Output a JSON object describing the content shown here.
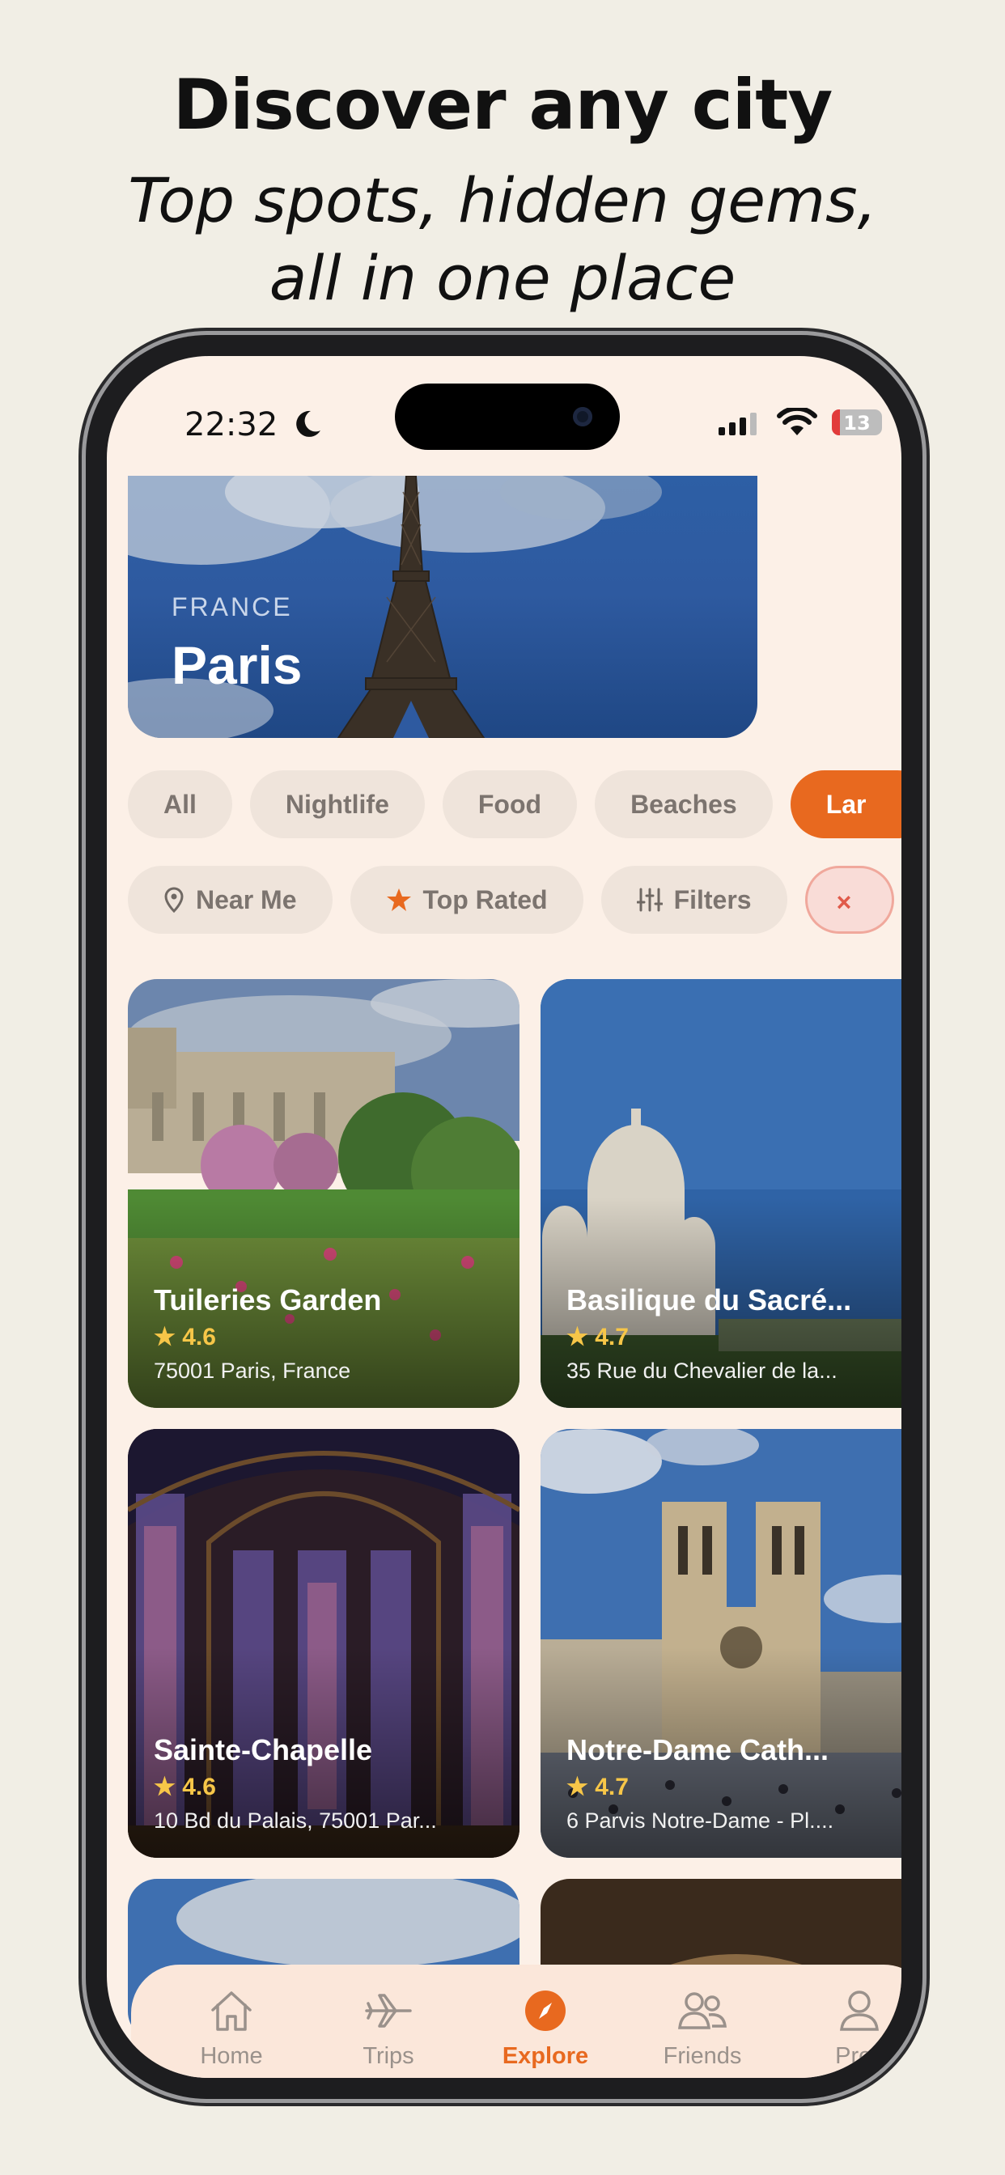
{
  "promo": {
    "headline": "Discover any city",
    "subline": "Top spots, hidden gems, all in one place"
  },
  "status_bar": {
    "time": "22:32",
    "battery_level": "13"
  },
  "hero": {
    "country": "FRANCE",
    "city": "Paris"
  },
  "categories": [
    {
      "label": "All",
      "active": false
    },
    {
      "label": "Nightlife",
      "active": false
    },
    {
      "label": "Food",
      "active": false
    },
    {
      "label": "Beaches",
      "active": false
    },
    {
      "label": "Lar",
      "active": true
    }
  ],
  "filters": {
    "near_me": "Near Me",
    "top_rated": "Top Rated",
    "filters": "Filters",
    "clear": "×"
  },
  "places": [
    {
      "name": "Tuileries Garden",
      "rating": "★ 4.6",
      "address": "75001 Paris, France"
    },
    {
      "name": "Basilique du Sacré...",
      "rating": "★ 4.7",
      "address": "35 Rue du Chevalier de la..."
    },
    {
      "name": "Sainte-Chapelle",
      "rating": "★ 4.6",
      "address": "10 Bd du Palais, 75001 Par..."
    },
    {
      "name": "Notre-Dame Cath...",
      "rating": "★ 4.7",
      "address": "6 Parvis Notre-Dame - Pl...."
    }
  ],
  "tab_bar": {
    "home": "Home",
    "trips": "Trips",
    "explore": "Explore",
    "friends": "Friends",
    "profile": "Profi"
  },
  "colors": {
    "accent": "#e8691f",
    "background": "#f1eee5",
    "screen": "#fcf0e7",
    "chip": "#efe4db",
    "rating_star": "#f7c648"
  }
}
